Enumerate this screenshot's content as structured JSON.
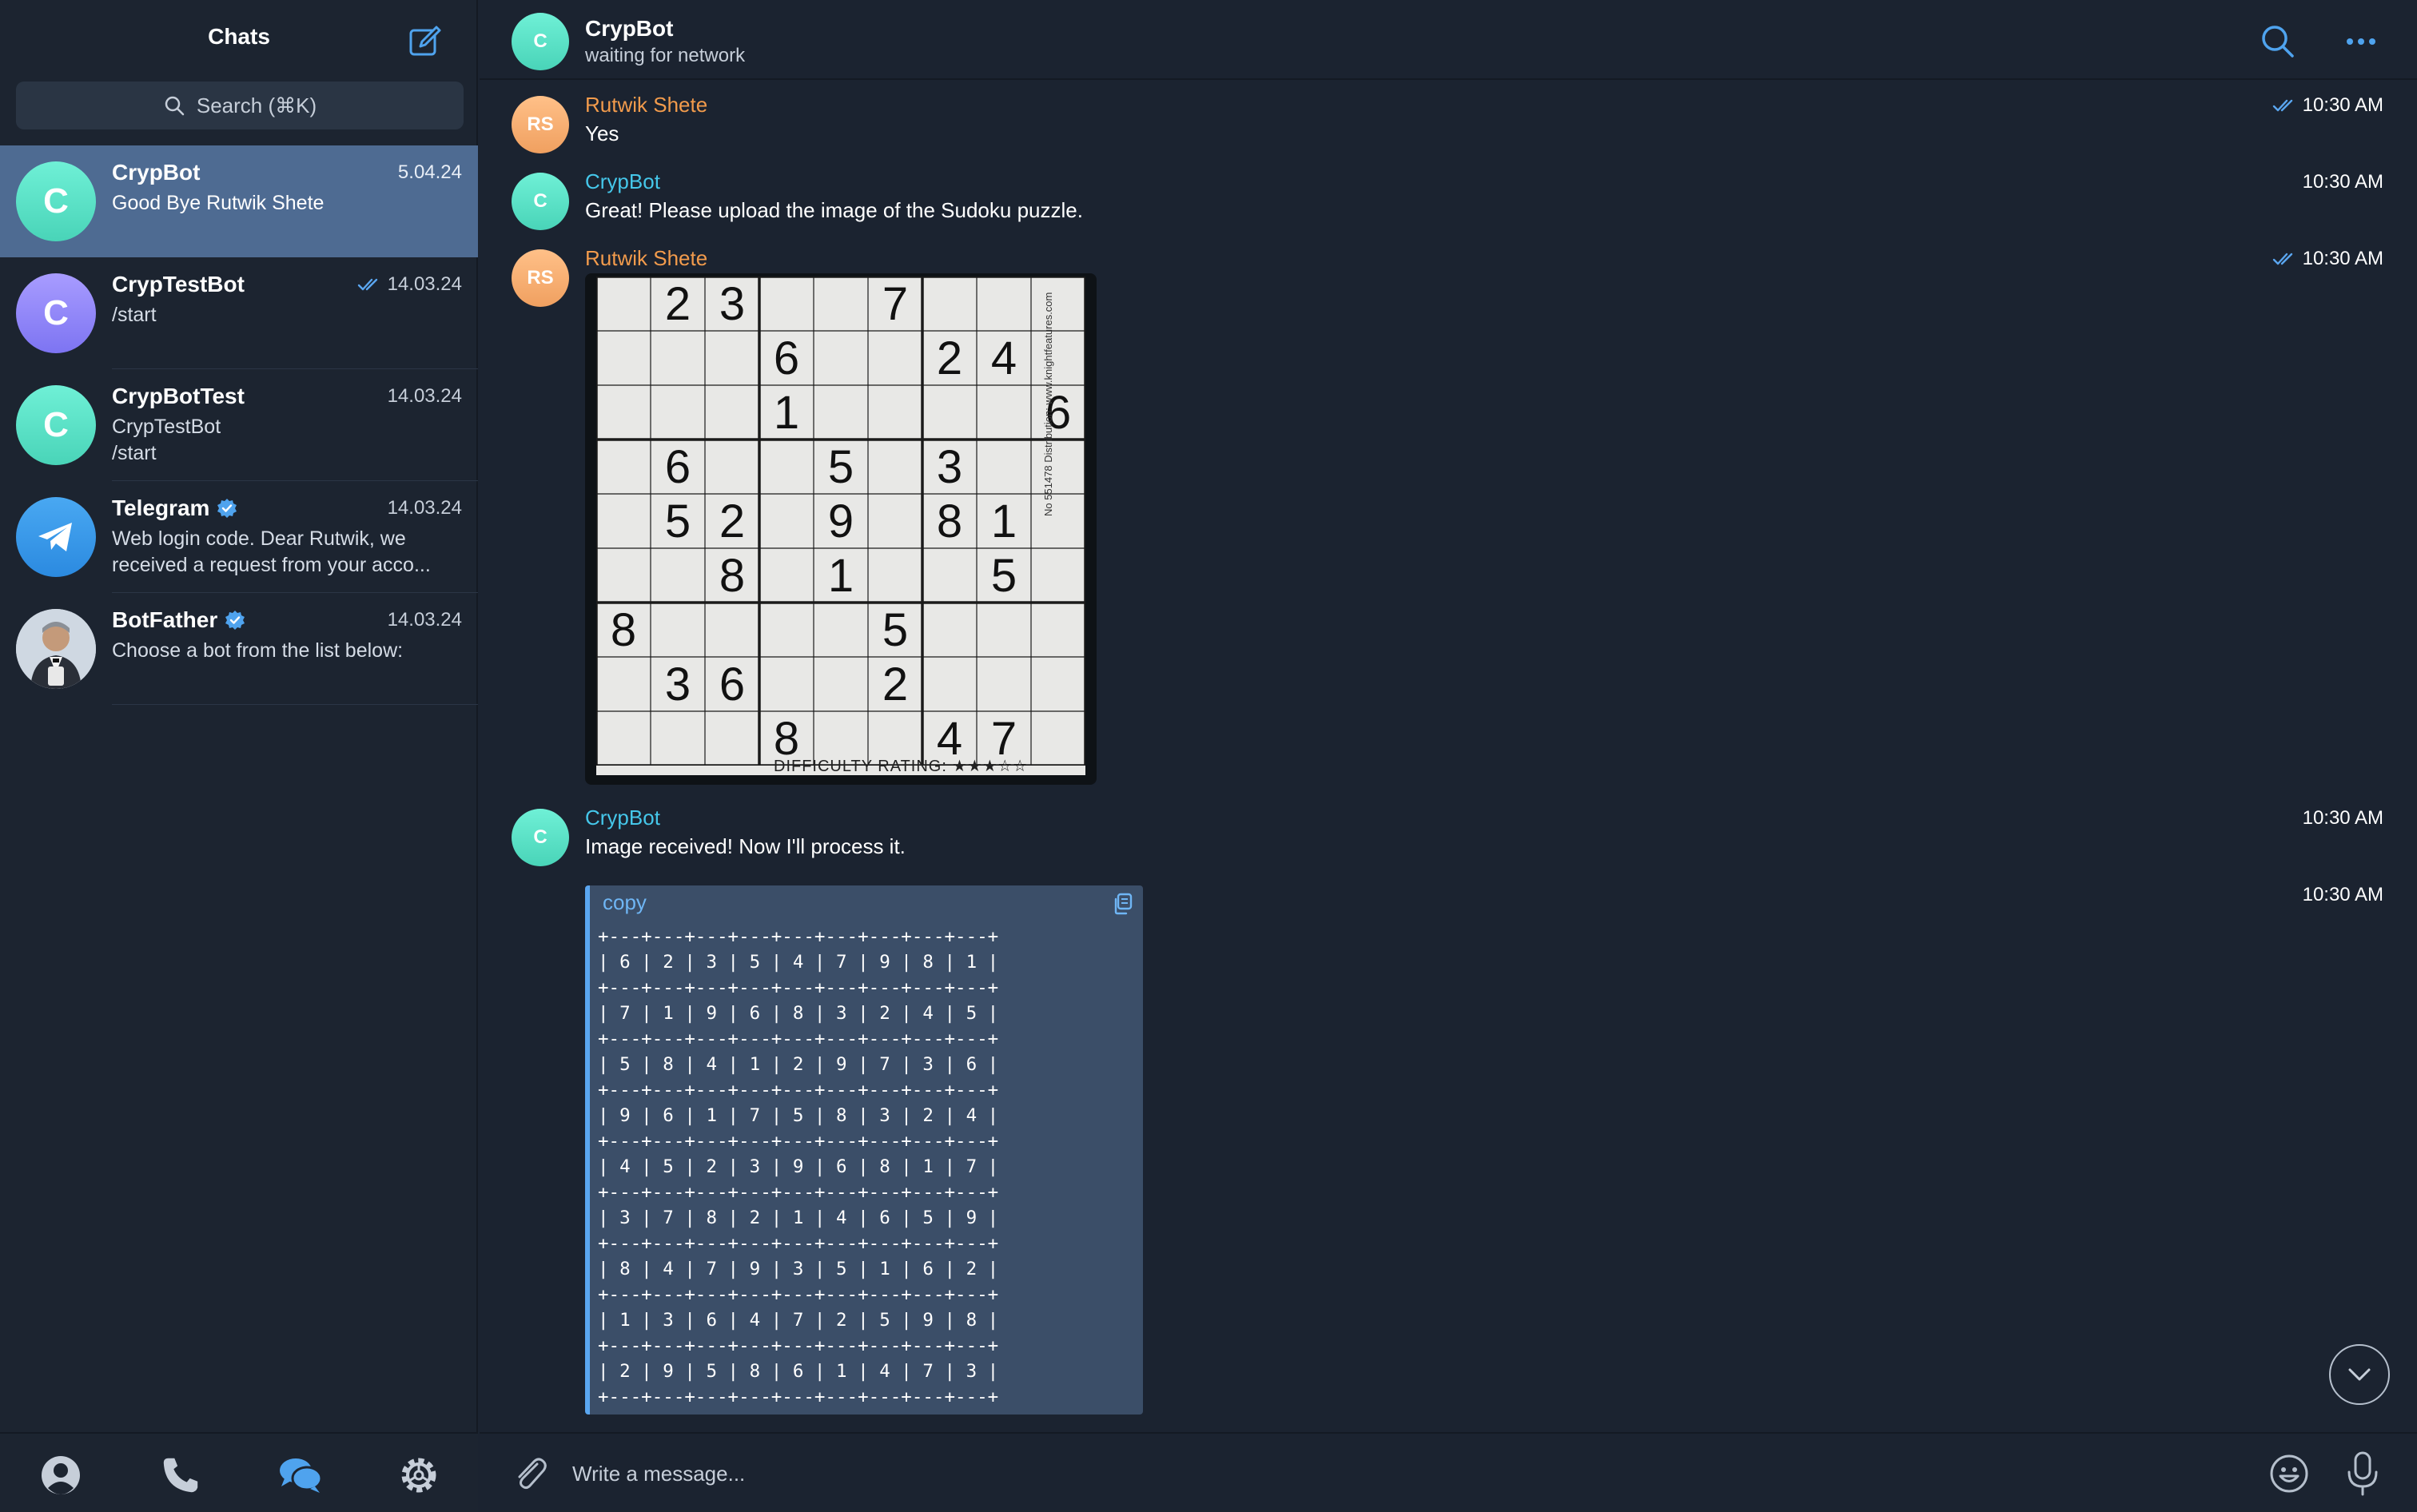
{
  "sidebar": {
    "title": "Chats",
    "search_placeholder": "Search (⌘K)",
    "chats": [
      {
        "name": "CrypBot",
        "date": "5.04.24",
        "preview": "Good Bye Rutwik Shete",
        "avatar": "C",
        "read_check": false,
        "verified": false
      },
      {
        "name": "CrypTestBot",
        "date": "14.03.24",
        "preview": "/start",
        "avatar": "C",
        "read_check": true,
        "verified": false
      },
      {
        "name": "CrypBotTest",
        "date": "14.03.24",
        "preview_line1": "CrypTestBot",
        "preview_line2": "/start",
        "avatar": "C",
        "read_check": false,
        "verified": false
      },
      {
        "name": "Telegram",
        "date": "14.03.24",
        "preview_line1": "Web login code. Dear Rutwik, we",
        "preview_line2": "received a request from your acco...",
        "avatar_icon": "paper-plane-icon",
        "verified": true
      },
      {
        "name": "BotFather",
        "date": "14.03.24",
        "preview": "Choose a bot from the list below:",
        "avatar_icon": "botfather-portrait",
        "verified": true
      }
    ],
    "nav": [
      "contacts-icon",
      "calls-icon",
      "chats-icon",
      "settings-icon"
    ]
  },
  "header": {
    "avatar": "C",
    "name": "CrypBot",
    "status": "waiting for network"
  },
  "messages": [
    {
      "sender": "Rutwik Shete",
      "avatar": "RS",
      "text": "Yes",
      "time": "10:30 AM",
      "read": true
    },
    {
      "sender": "CrypBot",
      "avatar": "C",
      "text": "Great! Please upload the image of the Sudoku puzzle.",
      "time": "10:30 AM",
      "read": false
    },
    {
      "sender": "Rutwik Shete",
      "avatar": "RS",
      "text": "",
      "time": "10:30 AM",
      "read": true,
      "attachment": "sudoku-photo"
    },
    {
      "sender": "CrypBot",
      "avatar": "C",
      "text": "Image received! Now I'll process it.",
      "time": "10:30 AM",
      "read": false
    },
    {
      "sender": "",
      "text": "",
      "time": "10:30 AM",
      "read": false,
      "attachment": "code-block"
    }
  ],
  "sudoku_photo": {
    "cells": [
      {
        "r": 0,
        "c": 1,
        "v": "2"
      },
      {
        "r": 0,
        "c": 2,
        "v": "3"
      },
      {
        "r": 0,
        "c": 5,
        "v": "7"
      },
      {
        "r": 1,
        "c": 3,
        "v": "6"
      },
      {
        "r": 1,
        "c": 6,
        "v": "2"
      },
      {
        "r": 1,
        "c": 7,
        "v": "4"
      },
      {
        "r": 2,
        "c": 3,
        "v": "1"
      },
      {
        "r": 2,
        "c": 8,
        "v": "6"
      },
      {
        "r": 3,
        "c": 1,
        "v": "6"
      },
      {
        "r": 3,
        "c": 4,
        "v": "5"
      },
      {
        "r": 3,
        "c": 6,
        "v": "3"
      },
      {
        "r": 4,
        "c": 1,
        "v": "5"
      },
      {
        "r": 4,
        "c": 2,
        "v": "2"
      },
      {
        "r": 4,
        "c": 4,
        "v": "9"
      },
      {
        "r": 4,
        "c": 6,
        "v": "8"
      },
      {
        "r": 4,
        "c": 7,
        "v": "1"
      },
      {
        "r": 5,
        "c": 2,
        "v": "8"
      },
      {
        "r": 5,
        "c": 4,
        "v": "1"
      },
      {
        "r": 5,
        "c": 7,
        "v": "5"
      },
      {
        "r": 6,
        "c": 0,
        "v": "8"
      },
      {
        "r": 6,
        "c": 5,
        "v": "5"
      },
      {
        "r": 7,
        "c": 1,
        "v": "3"
      },
      {
        "r": 7,
        "c": 2,
        "v": "6"
      },
      {
        "r": 7,
        "c": 5,
        "v": "2"
      },
      {
        "r": 8,
        "c": 3,
        "v": "8"
      },
      {
        "r": 8,
        "c": 6,
        "v": "4"
      },
      {
        "r": 8,
        "c": 7,
        "v": "7"
      }
    ],
    "rating_text": "DIFFICULTY RATING: ★★★☆☆",
    "side_text": "No 551478 Distribution: www.knightfeatures.com"
  },
  "code_block": {
    "language": "copy",
    "grid": [
      [
        6,
        2,
        3,
        5,
        4,
        7,
        9,
        8,
        1
      ],
      [
        7,
        1,
        9,
        6,
        8,
        3,
        2,
        4,
        5
      ],
      [
        5,
        8,
        4,
        1,
        2,
        9,
        7,
        3,
        6
      ],
      [
        9,
        6,
        1,
        7,
        5,
        8,
        3,
        2,
        4
      ],
      [
        4,
        5,
        2,
        3,
        9,
        6,
        8,
        1,
        7
      ],
      [
        3,
        7,
        8,
        2,
        1,
        4,
        6,
        5,
        9
      ],
      [
        8,
        4,
        7,
        9,
        3,
        5,
        1,
        6,
        2
      ],
      [
        1,
        3,
        6,
        4,
        7,
        2,
        5,
        9,
        8
      ],
      [
        2,
        9,
        5,
        8,
        6,
        1,
        4,
        7,
        3
      ]
    ]
  },
  "composer": {
    "placeholder": "Write a message..."
  },
  "colors": {
    "accent": "#5aa6f0",
    "active_chat": "#4e6b92",
    "sender_orange": "#f29b4c",
    "sender_teal": "#45c7ea",
    "code_bg": "#3b4e68"
  }
}
